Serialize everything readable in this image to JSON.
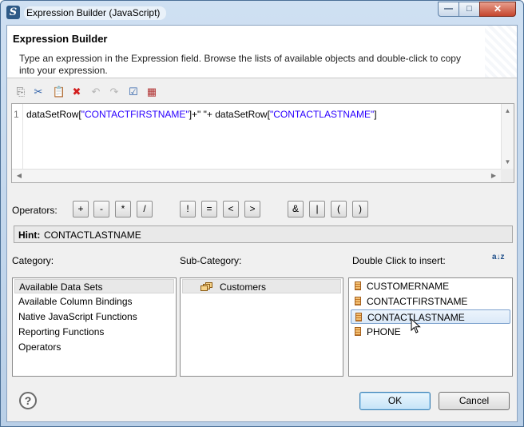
{
  "window": {
    "title": "Expression Builder (JavaScript)",
    "controls": {
      "minimize": "—",
      "maximize": "□",
      "close": "✕"
    }
  },
  "header": {
    "title": "Expression Builder",
    "description": "Type an expression in the Expression field. Browse the lists of available objects and double-click to copy into your expression."
  },
  "toolbar": {
    "items": [
      {
        "name": "copy-icon",
        "glyph": "⎘",
        "enabled": true
      },
      {
        "name": "cut-icon",
        "glyph": "✂",
        "enabled": true
      },
      {
        "name": "paste-icon",
        "glyph": "📋",
        "enabled": true
      },
      {
        "name": "delete-icon",
        "glyph": "✖",
        "enabled": true
      },
      {
        "name": "undo-icon",
        "glyph": "↶",
        "enabled": false
      },
      {
        "name": "redo-icon",
        "glyph": "↷",
        "enabled": false
      },
      {
        "name": "validate-icon",
        "glyph": "☑",
        "enabled": true
      },
      {
        "name": "calculator-icon",
        "glyph": "▦",
        "enabled": true
      }
    ]
  },
  "editor": {
    "line_number": "1",
    "code_parts": [
      {
        "text": "dataSetRow[",
        "type": "plain"
      },
      {
        "text": "\"CONTACTFIRSTNAME\"",
        "type": "str"
      },
      {
        "text": "]+\" \"+ dataSetRow[",
        "type": "plain"
      },
      {
        "text": "\"CONTACTLASTNAME\"",
        "type": "str"
      },
      {
        "text": "]",
        "type": "plain"
      }
    ],
    "scroll_up": "▲",
    "scroll_down": "▼",
    "scroll_left": "◀",
    "scroll_right": "▶"
  },
  "operators": {
    "label": "Operators:",
    "buttons": [
      "+",
      "-",
      "*",
      "/",
      "!",
      "=",
      "<",
      ">",
      "&",
      "|",
      "(",
      ")"
    ]
  },
  "hint": {
    "label": "Hint:",
    "value": "CONTACTLASTNAME"
  },
  "category": {
    "label": "Category:",
    "items": [
      "Available Data Sets",
      "Available Column Bindings",
      "Native JavaScript Functions",
      "Reporting Functions",
      "Operators"
    ],
    "selected_index": 0
  },
  "sub_category": {
    "label": "Sub-Category:",
    "items": [
      "Customers"
    ],
    "selected_index": 0
  },
  "insert": {
    "label": "Double Click to insert:",
    "sort_glyph": "a↓z",
    "items": [
      "CUSTOMERNAME",
      "CONTACTFIRSTNAME",
      "CONTACTLASTNAME",
      "PHONE"
    ],
    "hover_index": 2
  },
  "buttons": {
    "help": "?",
    "ok": "OK",
    "cancel": "Cancel"
  }
}
